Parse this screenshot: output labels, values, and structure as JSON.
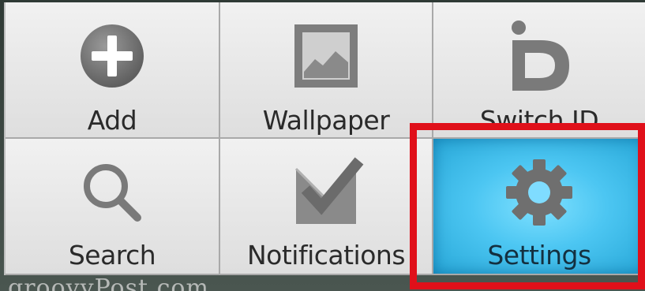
{
  "menu": {
    "items": [
      {
        "label": "Add",
        "icon": "add-icon"
      },
      {
        "label": "Wallpaper",
        "icon": "wallpaper-icon"
      },
      {
        "label": "Switch ID",
        "icon": "switch-id-icon"
      },
      {
        "label": "Search",
        "icon": "search-icon"
      },
      {
        "label": "Notifications",
        "icon": "notifications-icon"
      },
      {
        "label": "Settings",
        "icon": "gear-icon",
        "selected": true
      }
    ]
  },
  "watermark": {
    "text": "groovyPost.com"
  },
  "colors": {
    "selected_bg": "#4cc6f2",
    "highlight_border": "#e0101a",
    "icon_gray": "#7a7a7a"
  }
}
